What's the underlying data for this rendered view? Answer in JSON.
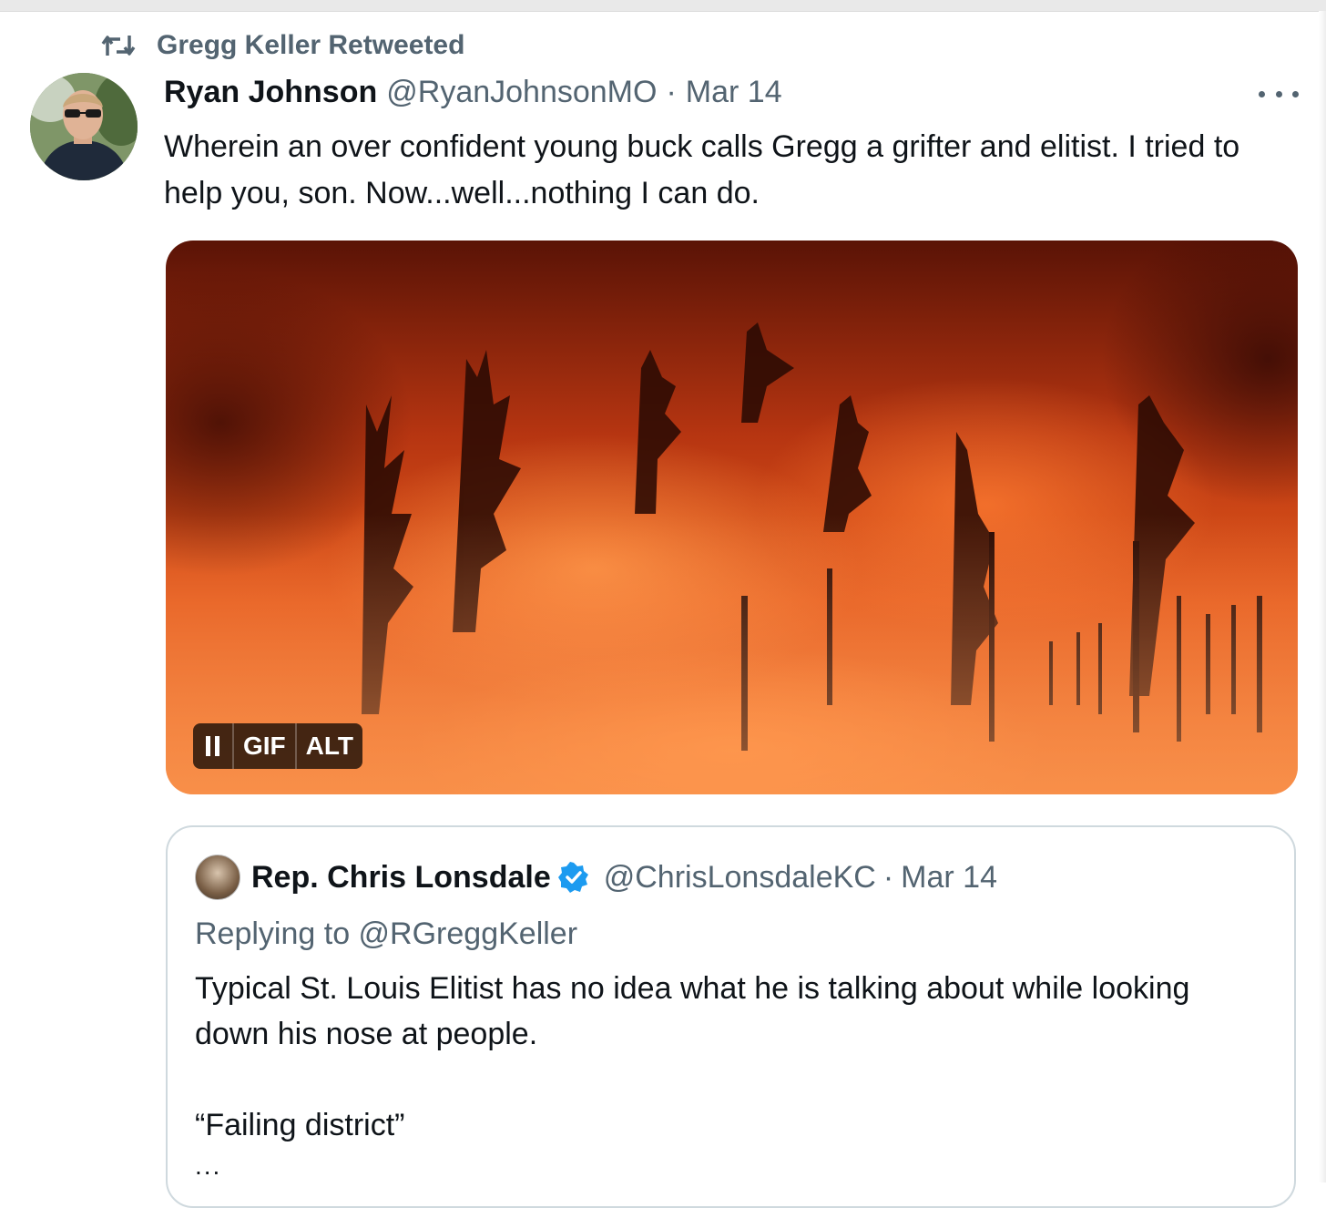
{
  "retweet": {
    "icon": "retweet-icon",
    "label": "Gregg Keller Retweeted"
  },
  "tweet": {
    "display_name": "Ryan Johnson",
    "handle": "@RyanJohnsonMO",
    "separator": "·",
    "date": "Mar 14",
    "more_icon": "more-horizontal-icon",
    "text": "Wherein an over confident young buck calls Gregg a grifter and elitist. I tried to help you, son. Now...well...nothing I can do.",
    "media": {
      "badges": {
        "pause_icon": "pause-icon",
        "gif": "GIF",
        "alt": "ALT"
      }
    }
  },
  "quote": {
    "display_name": "Rep. Chris Lonsdale",
    "verified_icon": "verified-badge-icon",
    "handle": "@ChrisLonsdaleKC",
    "separator": "·",
    "date": "Mar 14",
    "replying_to": "Replying to @RGreggKeller",
    "text_line1": "Typical St. Louis Elitist has no idea what he is talking about while looking down his nose at people.",
    "text_line2": "“Failing district”",
    "truncation": "..."
  },
  "colors": {
    "text_primary": "#0f1419",
    "text_secondary": "#536471",
    "verified_blue": "#1d9bf0",
    "border": "#cfd9de"
  }
}
